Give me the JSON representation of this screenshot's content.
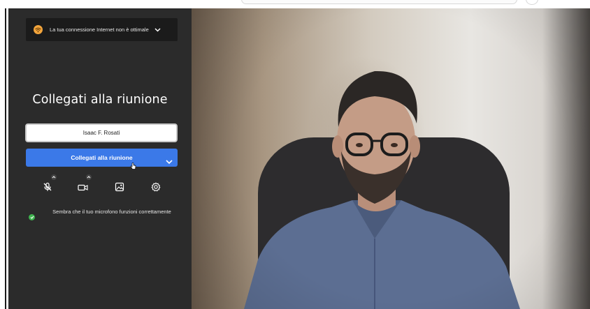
{
  "connection_banner": {
    "text": "La tua connessione Internet non è ottimale",
    "icon": "wifi-icon",
    "accent": "#f3a53c"
  },
  "title": "Collegati alla riunione",
  "name_field": {
    "value": "Isaac F. Rosati"
  },
  "join_button": {
    "label": "Collegati alla riunione",
    "color": "#3b79e8"
  },
  "controls": [
    {
      "name": "microphone-muted",
      "icon": "mic-off-icon",
      "has_menu": true
    },
    {
      "name": "camera",
      "icon": "video-camera-icon",
      "has_menu": true
    },
    {
      "name": "background-effects",
      "icon": "image-effects-icon",
      "has_menu": false
    },
    {
      "name": "settings",
      "icon": "gear-icon",
      "has_menu": false
    }
  ],
  "mic_status": {
    "text": "Sembra che il tuo microfono funzioni correttamente",
    "color": "#3fb34f"
  },
  "colors": {
    "panel_bg": "#2b2b2b",
    "banner_bg": "#1b1b1b"
  }
}
